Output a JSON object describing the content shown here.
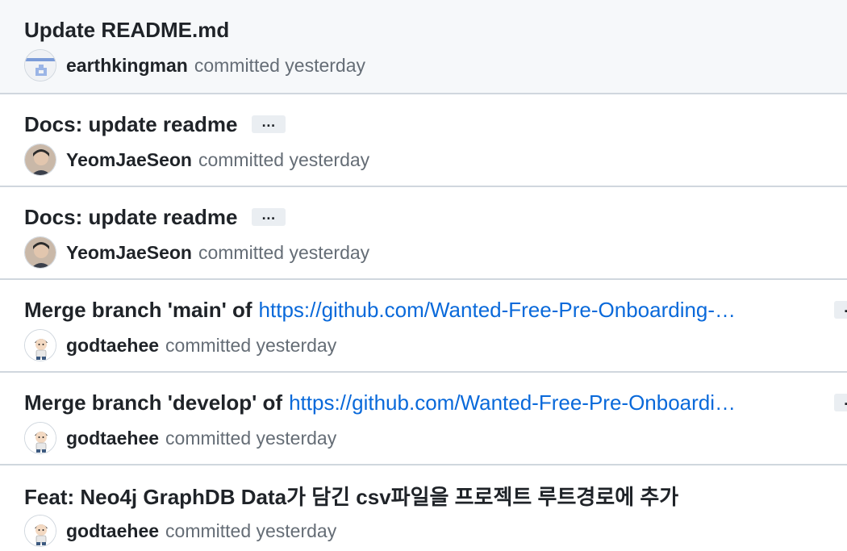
{
  "commits": [
    {
      "title": "Update README.md",
      "link": "",
      "author": "earthkingman",
      "time": "committed yesterday",
      "avatar": "earthkingman-avatar",
      "ellipsis": ""
    },
    {
      "title": "Docs: update readme",
      "link": "",
      "author": "YeomJaeSeon",
      "time": "committed yesterday",
      "avatar": "yeomjaeseon-avatar",
      "ellipsis": "…"
    },
    {
      "title": "Docs: update readme",
      "link": "",
      "author": "YeomJaeSeon",
      "time": "committed yesterday",
      "avatar": "yeomjaeseon-avatar",
      "ellipsis": "…"
    },
    {
      "title": "Merge branch 'main' of",
      "link": "https://github.com/Wanted-Free-Pre-Onboarding-…",
      "author": "godtaehee",
      "time": "committed yesterday",
      "avatar": "godtaehee-avatar",
      "ellipsis": "…"
    },
    {
      "title": "Merge branch 'develop' of",
      "link": "https://github.com/Wanted-Free-Pre-Onboardi…",
      "author": "godtaehee",
      "time": "committed yesterday",
      "avatar": "godtaehee-avatar",
      "ellipsis": "…"
    },
    {
      "title": "Feat: Neo4j GraphDB Data가 담긴 csv파일을 프로젝트 루트경로에 추가",
      "link": "",
      "author": "godtaehee",
      "time": "committed yesterday",
      "avatar": "godtaehee-avatar",
      "ellipsis": ""
    }
  ]
}
